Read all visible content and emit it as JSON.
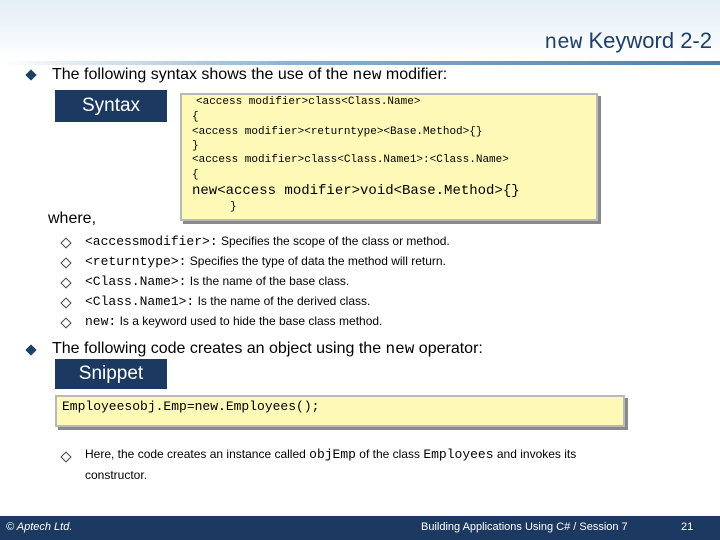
{
  "title": {
    "keyword": "new",
    "rest": "Keyword 2-2"
  },
  "point1": {
    "prefix": "The following syntax shows the use of the ",
    "keyword": "new",
    "suffix": " modifier:"
  },
  "syntax_label": "Syntax",
  "syntax_lines": [
    "<access modifier>class<Class.Name>",
    "{",
    "<access modifier><returntype><Base.Method>{}",
    "}",
    "<access modifier>class<Class.Name1>:<Class.Name>",
    "{",
    "new<access modifier>void<Base.Method>{}",
    "}"
  ],
  "where_label": "where,",
  "where_items": [
    {
      "code": "<accessmodifier>:",
      "text": "Specifies the scope of the class or method."
    },
    {
      "code": "<returntype>:",
      "text": "Specifies the type of data the method will return."
    },
    {
      "code": "<Class.Name>:",
      "text": "Is the name of the base class."
    },
    {
      "code": "<Class.Name1>:",
      "text": "Is the name of the derived class."
    },
    {
      "code": "new:",
      "text": "Is a keyword used to hide the base class method."
    }
  ],
  "point2": {
    "prefix": "The following code creates an object using the ",
    "keyword": "new",
    "suffix": " operator:"
  },
  "snippet_label": "Snippet",
  "snippet_code": "Employeesobj.Emp=new.Employees();",
  "explanation": {
    "line1_prefix": "Here, the code creates an instance called ",
    "code1": "objEmp",
    "line1_mid": " of the class ",
    "code2": "Employees",
    "line1_suffix": " and invokes its",
    "line2": "constructor."
  },
  "footer": {
    "left": "© Aptech Ltd.",
    "center": "Building Applications Using C# / Session 7",
    "page": "21"
  },
  "colors": {
    "navy": "#1c3a61",
    "code_bg": "#fff9b8"
  }
}
